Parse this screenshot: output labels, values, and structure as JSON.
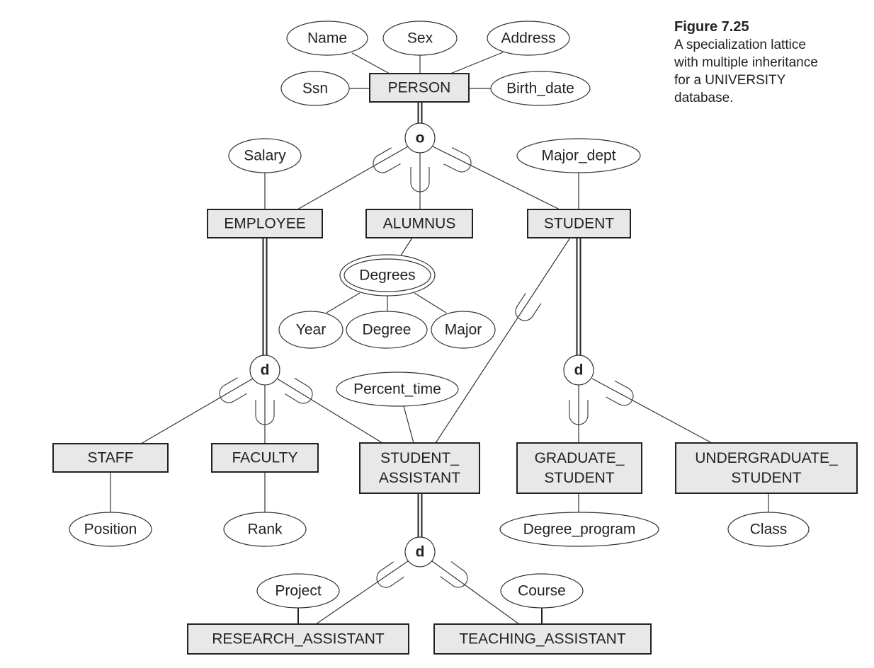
{
  "caption": {
    "figure_label": "Figure 7.25",
    "lines": [
      "A specialization lattice",
      "with multiple inheritance",
      "for a UNIVERSITY",
      "database."
    ]
  },
  "entities": {
    "person": {
      "lines": [
        "PERSON"
      ]
    },
    "employee": {
      "lines": [
        "EMPLOYEE"
      ]
    },
    "alumnus": {
      "lines": [
        "ALUMNUS"
      ]
    },
    "student": {
      "lines": [
        "STUDENT"
      ]
    },
    "staff": {
      "lines": [
        "STAFF"
      ]
    },
    "faculty": {
      "lines": [
        "FACULTY"
      ]
    },
    "student_assistant": {
      "lines": [
        "STUDENT_",
        "ASSISTANT"
      ]
    },
    "graduate_student": {
      "lines": [
        "GRADUATE_",
        "STUDENT"
      ]
    },
    "undergraduate_student": {
      "lines": [
        "UNDERGRADUATE_",
        "STUDENT"
      ]
    },
    "research_assistant": {
      "lines": [
        "RESEARCH_ASSISTANT"
      ]
    },
    "teaching_assistant": {
      "lines": [
        "TEACHING_ASSISTANT"
      ]
    }
  },
  "attributes": {
    "name": "Name",
    "sex": "Sex",
    "address": "Address",
    "ssn": "Ssn",
    "birth_date": "Birth_date",
    "salary": "Salary",
    "major_dept": "Major_dept",
    "degrees": "Degrees",
    "year": "Year",
    "degree": "Degree",
    "major": "Major",
    "percent_time": "Percent_time",
    "position": "Position",
    "rank": "Rank",
    "degree_program": "Degree_program",
    "class": "Class",
    "project": "Project",
    "course": "Course"
  },
  "specializations": {
    "person_overlap": "o",
    "employee_disjoint": "d",
    "student_disjoint": "d",
    "student_assistant_disjoint": "d"
  },
  "multivalued_attributes": [
    "degrees"
  ]
}
